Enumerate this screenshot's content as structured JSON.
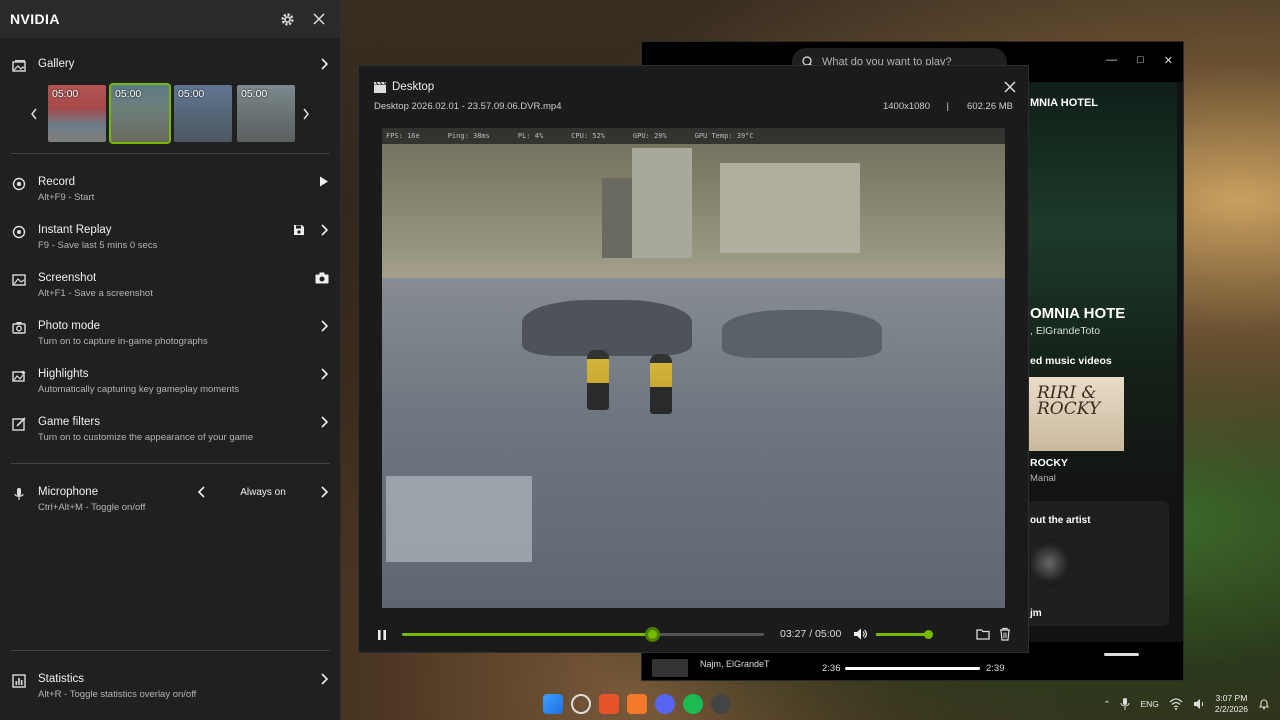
{
  "nvidia": {
    "title": "NVIDIA",
    "gallery_label": "Gallery",
    "thumbnails": [
      {
        "duration": "05:00",
        "selected": false
      },
      {
        "duration": "05:00",
        "selected": true
      },
      {
        "duration": "05:00",
        "selected": false
      },
      {
        "duration": "05:00",
        "selected": false
      }
    ],
    "items": [
      {
        "label": "Record",
        "sub": "Alt+F9 - Start"
      },
      {
        "label": "Instant Replay",
        "sub": "F9 - Save last 5 mins 0 secs"
      },
      {
        "label": "Screenshot",
        "sub": "Alt+F1 - Save a screenshot"
      },
      {
        "label": "Photo mode",
        "sub": "Turn on to capture in-game photographs"
      },
      {
        "label": "Highlights",
        "sub": "Automatically capturing key gameplay moments"
      },
      {
        "label": "Game filters",
        "sub": "Turn on to customize the appearance of your game"
      }
    ],
    "microphone": {
      "label": "Microphone",
      "sub": "Ctrl+Alt+M - Toggle on/off",
      "value": "Always on"
    },
    "statistics": {
      "label": "Statistics",
      "sub": "Alt+R - Toggle statistics overlay on/off"
    },
    "accent": "#76b900"
  },
  "player": {
    "title": "Desktop",
    "file": "Desktop 2026.02.01 - 23.57.09.06.DVR.mp4",
    "resolution": "1400x1080",
    "separator": "|",
    "size": "602.26 MB",
    "time": "03:27 / 05:00",
    "progress": 0.69,
    "volume": 1.0,
    "hud": [
      "FPS: 16e",
      "Ping: 38ms",
      "PL: 4%",
      "CPU: 52%",
      "GPU: 29%",
      "GPU Temp: 39°C"
    ]
  },
  "spotify": {
    "search_placeholder": "What do you want to play?",
    "playlist": "MNIA HOTEL",
    "big_title": "OMNIA HOTE",
    "artists": ", ElGrandeToto",
    "related_label": "ed music videos",
    "cover_text": "RIRI & ROCKY",
    "track": "ROCKY",
    "track_artist": "Manal",
    "about_label": "out the artist",
    "artist_name": "jm",
    "now_playing": "Najm, ElGrandeT",
    "time_elapsed": "2:36",
    "time_total": "2:39"
  },
  "taskbar": {
    "lang": "ENG",
    "time": "3:07 PM",
    "date": "2/2/2026"
  }
}
